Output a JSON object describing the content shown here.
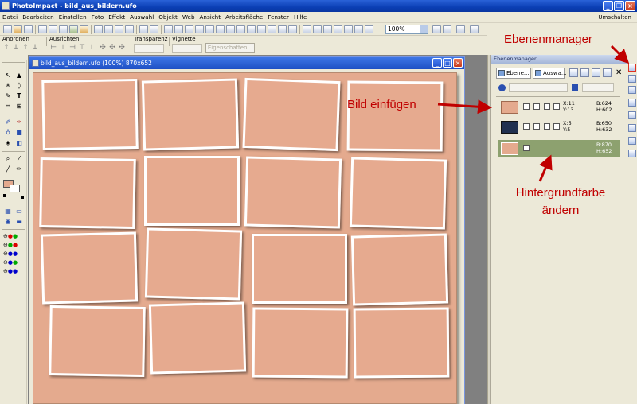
{
  "window": {
    "title": "PhotoImpact - bild_aus_bildern.ufo"
  },
  "menu": {
    "items": [
      "Datei",
      "Bearbeiten",
      "Einstellen",
      "Foto",
      "Effekt",
      "Auswahl",
      "Objekt",
      "Web",
      "Ansicht",
      "Arbeitsfläche",
      "Fenster",
      "Hilfe"
    ],
    "right_label": "Umschalten"
  },
  "toolbar": {
    "zoom_value": "100%"
  },
  "attribute_bar": {
    "group_labels": [
      "Anordnen",
      "Ausrichten",
      "Transparenz",
      "Vignette"
    ],
    "properties_button": "Eigenschaften..."
  },
  "document": {
    "title": "bild_aus_bildern.ufo (100%) 870x652",
    "photo_count": 16
  },
  "layer_manager": {
    "title": "Ebenenmanager",
    "tabs": [
      "Ebene...",
      "Auswa..."
    ],
    "layers": [
      {
        "x": "X:11",
        "y": "Y:13",
        "w": "B:624",
        "h": "H:602",
        "selected": false
      },
      {
        "x": "X:5",
        "y": "Y:5",
        "w": "B:650",
        "h": "H:632",
        "selected": false
      },
      {
        "x": "",
        "y": "",
        "w": "B:870",
        "h": "H:652",
        "selected": true
      }
    ],
    "background_color": "#e4aa8e"
  },
  "annotations": {
    "manager": "Ebenenmanager",
    "insert": "Bild einfügen",
    "bg_line1": "Hintergrundfarbe",
    "bg_line2": "ändern"
  },
  "colors": {
    "title_blue": "#0b3fb5",
    "canvas": "#e4aa8e",
    "annotation_red": "#c00000",
    "selected_layer": "#8da16f"
  }
}
